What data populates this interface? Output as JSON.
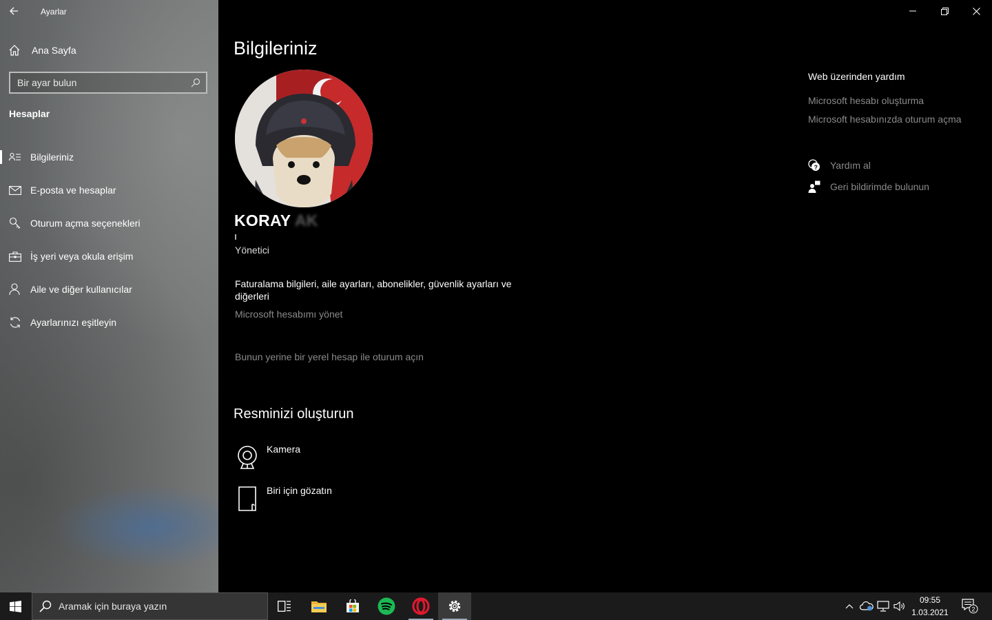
{
  "window": {
    "title": "Ayarlar"
  },
  "sidebar": {
    "home_label": "Ana Sayfa",
    "search_placeholder": "Bir ayar bulun",
    "section_title": "Hesaplar",
    "items": [
      {
        "label": "Bilgileriniz",
        "icon": "person-card-icon",
        "active": true
      },
      {
        "label": "E-posta ve hesaplar",
        "icon": "mail-icon"
      },
      {
        "label": "Oturum açma seçenekleri",
        "icon": "key-icon"
      },
      {
        "label": "İş yeri veya okula erişim",
        "icon": "briefcase-icon"
      },
      {
        "label": "Aile ve diğer kullanıcılar",
        "icon": "people-icon"
      },
      {
        "label": "Ayarlarınızı eşitleyin",
        "icon": "sync-icon"
      }
    ]
  },
  "main": {
    "title": "Bilgileriniz",
    "user": {
      "first_name": "KORAY",
      "last_name_obscured": "AK",
      "role": "Yönetici"
    },
    "billing_text": "Faturalama bilgileri, aile ayarları, abonelikler, güvenlik ayarları ve diğerleri",
    "manage_link": "Microsoft hesabımı yönet",
    "local_link": "Bunun yerine bir yerel hesap ile oturum açın",
    "picture_section_title": "Resminizi oluşturun",
    "camera_label": "Kamera",
    "browse_label": "Biri için gözatın"
  },
  "help": {
    "title": "Web üzerinden yardım",
    "links": [
      "Microsoft hesabı oluşturma",
      "Microsoft hesabınızda oturum açma"
    ],
    "get_help": "Yardım al",
    "feedback": "Geri bildirimde bulunun"
  },
  "taskbar": {
    "search_placeholder": "Aramak için buraya yazın",
    "time": "09:55",
    "date": "1.03.2021",
    "notification_count": "2",
    "apps": [
      "task-view-icon",
      "file-explorer-icon",
      "store-icon",
      "spotify-icon",
      "opera-icon",
      "settings-gear-icon"
    ]
  },
  "colors": {
    "link_gray": "#8a8a8a",
    "taskbar": "#1b1b1b",
    "spotify": "#1db954",
    "opera": "#e0192e"
  }
}
